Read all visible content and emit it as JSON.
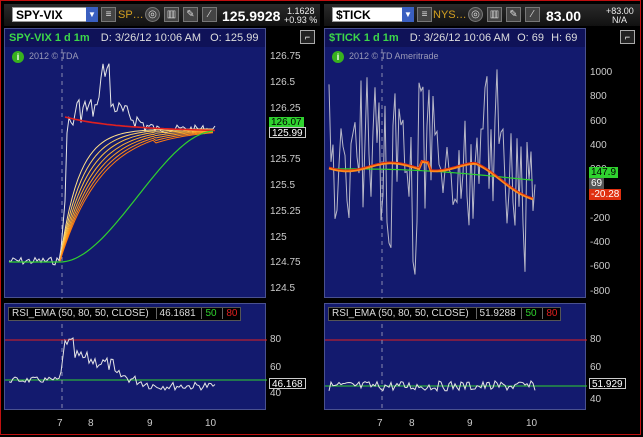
{
  "left": {
    "symbol": "SPY-VIX",
    "description": "SP…",
    "last": "125.9928",
    "change": "1.1628",
    "change_pct": "+0.93 %",
    "title": "SPY-VIX 1 d 1m",
    "date": "D: 3/26/12 10:06 AM",
    "open": "O: 125.99",
    "watermark": "2012 © TDA",
    "yticks": [
      "126.75",
      "126.5",
      "126.25",
      "126",
      "125.75",
      "125.5",
      "125.25",
      "125",
      "124.75",
      "124.5"
    ],
    "tag_top": "126.07",
    "tag_price": "125.99",
    "rsi_label": "RSI_EMA (50, 80, 50, CLOSE)",
    "rsi_value": "46.1681",
    "rsi_mid": "50",
    "rsi_high": "80",
    "rsi_ticks": [
      "80",
      "60",
      "40"
    ],
    "rsi_tag": "46.168",
    "xticks": [
      "7",
      "8",
      "9",
      "10"
    ]
  },
  "right": {
    "symbol": "$TICK",
    "description": "NYS…",
    "last": "83.00",
    "change": "+83.00",
    "change_pct": "N/A",
    "title": "$TICK 1 d 1m",
    "date": "D: 3/26/12 10:06 AM",
    "open": "O: 69",
    "high": "H: 69",
    "watermark": "2012 © TD Ameritrade",
    "yticks": [
      "1000",
      "800",
      "600",
      "400",
      "200",
      "0",
      "-200",
      "-400",
      "-600",
      "-800"
    ],
    "tag_green": "147.9",
    "tag_price": "69",
    "tag_orange": "-20.28",
    "rsi_label": "RSI_EMA (50, 80, 50, CLOSE)",
    "rsi_value": "51.9288",
    "rsi_mid": "50",
    "rsi_high": "80",
    "rsi_ticks": [
      "80",
      "60",
      "40"
    ],
    "rsi_tag": "51.929",
    "xticks": [
      "7",
      "8",
      "9",
      "10"
    ]
  },
  "icons": [
    "dropdown-icon",
    "settings-icon",
    "chart-icon",
    "edit-icon",
    "drawing-icon",
    "style-icon",
    "info-icon"
  ],
  "colors": {
    "plot_bg": "#131a6e",
    "price": "#e6e6e6",
    "green": "#2fd22f",
    "orange": "#ff8a1a",
    "red": "#e02020"
  }
}
